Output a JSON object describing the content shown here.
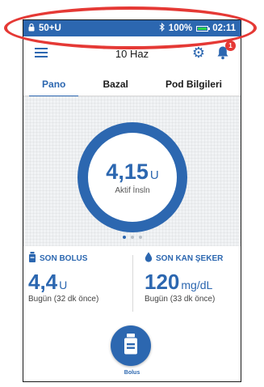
{
  "status_bar": {
    "lock_icon": "lock-icon",
    "pod_status": "50+U",
    "bluetooth_icon": "bluetooth-icon",
    "battery_percent": "100%",
    "time": "02:11"
  },
  "app_bar": {
    "title": "10 Haz",
    "notification_count": "1"
  },
  "tabs": [
    {
      "label": "Pano",
      "active": true
    },
    {
      "label": "Bazal",
      "active": false
    },
    {
      "label": "Pod Bilgileri",
      "active": false
    }
  ],
  "iob": {
    "value": "4,15",
    "unit": "U",
    "label": "Aktif İnsln"
  },
  "pager": {
    "count": 3,
    "active_index": 0
  },
  "last_bolus": {
    "title": "SON BOLUS",
    "value": "4,4",
    "unit": "U",
    "subtitle": "Bugün (32 dk önce)"
  },
  "last_bg": {
    "title": "SON KAN ŞEKER",
    "value": "120",
    "unit": "mg/dL",
    "subtitle": "Bugün (33 dk önce)"
  },
  "bolus_button": {
    "label": "Bolus"
  },
  "colors": {
    "primary": "#2c67b0",
    "annotation": "#e53935",
    "badge": "#e53935",
    "battery": "#2bd14a"
  }
}
